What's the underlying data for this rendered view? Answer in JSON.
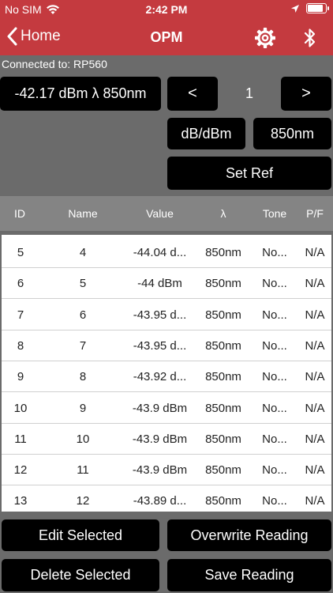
{
  "status_bar": {
    "carrier": "No SIM",
    "time": "2:42 PM"
  },
  "nav": {
    "back_label": "Home",
    "title": "OPM"
  },
  "connection": {
    "text": "Connected to: RP560"
  },
  "meter": {
    "reading": "-42.17 dBm λ 850nm",
    "prev_label": "<",
    "channel": "1",
    "next_label": ">",
    "unit_label": "dB/dBm",
    "wavelength_label": "850nm",
    "set_ref_label": "Set Ref"
  },
  "table": {
    "headers": [
      "ID",
      "Name",
      "Value",
      "λ",
      "Tone",
      "P/F"
    ],
    "rows": [
      [
        "5",
        "4",
        "-44.04 d...",
        "850nm",
        "No...",
        "N/A"
      ],
      [
        "6",
        "5",
        "-44 dBm",
        "850nm",
        "No...",
        "N/A"
      ],
      [
        "7",
        "6",
        "-43.95 d...",
        "850nm",
        "No...",
        "N/A"
      ],
      [
        "8",
        "7",
        "-43.95 d...",
        "850nm",
        "No...",
        "N/A"
      ],
      [
        "9",
        "8",
        "-43.92 d...",
        "850nm",
        "No...",
        "N/A"
      ],
      [
        "10",
        "9",
        "-43.9 dBm",
        "850nm",
        "No...",
        "N/A"
      ],
      [
        "11",
        "10",
        "-43.9 dBm",
        "850nm",
        "No...",
        "N/A"
      ],
      [
        "12",
        "11",
        "-43.9 dBm",
        "850nm",
        "No...",
        "N/A"
      ],
      [
        "13",
        "12",
        "-43.89 d...",
        "850nm",
        "No...",
        "N/A"
      ]
    ]
  },
  "actions": {
    "edit_selected": "Edit Selected",
    "overwrite_reading": "Overwrite Reading",
    "delete_selected": "Delete Selected",
    "save_reading": "Save Reading"
  },
  "colors": {
    "nav_bg": "#c43a3f",
    "body_bg": "#6b6b6b",
    "button_bg": "#000000",
    "table_header_bg": "#848484"
  },
  "icons": [
    "wifi-icon",
    "location-arrow-icon",
    "battery-icon",
    "chevron-left-icon",
    "gear-icon",
    "bluetooth-icon"
  ]
}
